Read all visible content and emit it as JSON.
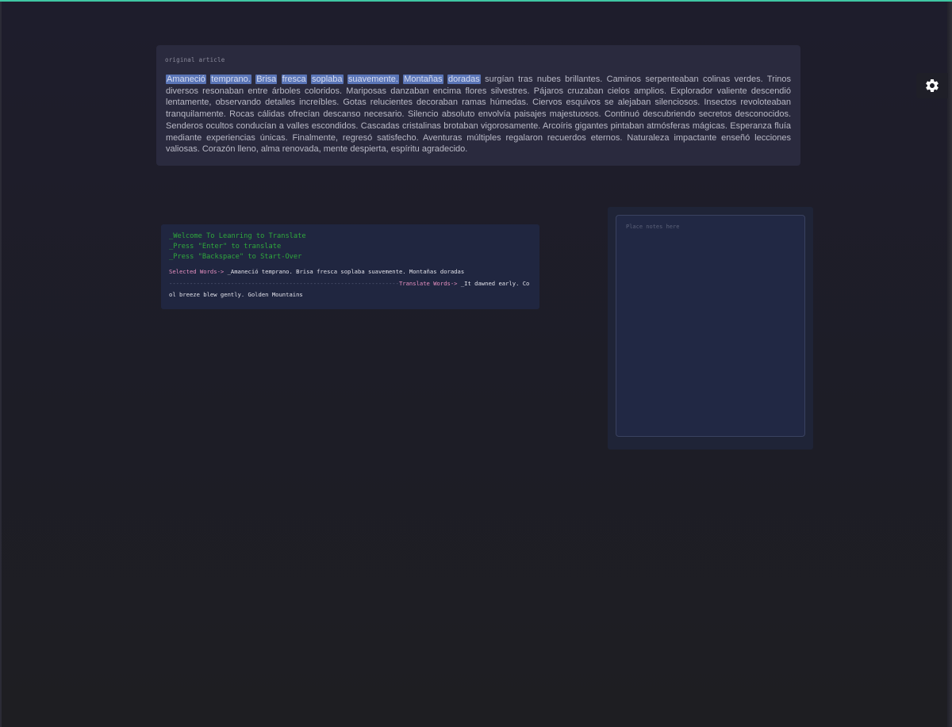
{
  "colors": {
    "accent_top": "#3fc7a4",
    "highlight": "#5a75b7",
    "terminal_green": "#2fa83c",
    "terminal_pink": "#e58fc0"
  },
  "article": {
    "label": "original article",
    "highlighted_words": [
      "Amaneció",
      "temprano.",
      "Brisa",
      "fresca",
      "soplaba",
      "suavemente.",
      "Montañas",
      "doradas"
    ],
    "rest_text": "surgían tras nubes brillantes. Caminos serpenteaban colinas verdes. Trinos diversos resonaban entre árboles coloridos. Mariposas danzaban encima flores silvestres. Pájaros cruzaban cielos amplios. Explorador valiente descendió lentamente, observando detalles increíbles. Gotas relucientes decoraban ramas húmedas. Ciervos esquivos se alejaban silenciosos. Insectos revoloteaban tranquilamente. Rocas cálidas ofrecían descanso necesario. Silencio absoluto envolvía paisajes majestuosos. Continuó descubriendo secretos desconocidos. Senderos ocultos conducían a valles escondidos. Cascadas cristalinas brotaban vigorosamente. Arcoíris gigantes pintaban atmósferas mágicas. Esperanza fluía mediante experiencias únicas. Finalmente, regresó satisfecho. Aventuras múltiples regalaron recuerdos eternos. Naturaleza impactante enseñó lecciones valiosas. Corazón lleno, alma renovada, mente despierta, espíritu agradecido."
  },
  "settings": {
    "icon": "gear-icon"
  },
  "terminal": {
    "welcome_lines": [
      "_Welcome To Leanring to Translate",
      "_Press \"Enter\" to translate",
      "_Press \"Backspace\" to Start-Over"
    ],
    "selected_label": "Selected Words->",
    "selected_value": " _Amaneció temprano. Brisa fresca soplaba suavemente. Montañas doradas",
    "divider": "-------------------------------------------------------------------",
    "translate_label": "Translate Words->",
    "translate_value": " _It dawned early. Cool breeze blew gently. Golden Mountains"
  },
  "notes": {
    "placeholder": "Place notes here",
    "value": ""
  }
}
